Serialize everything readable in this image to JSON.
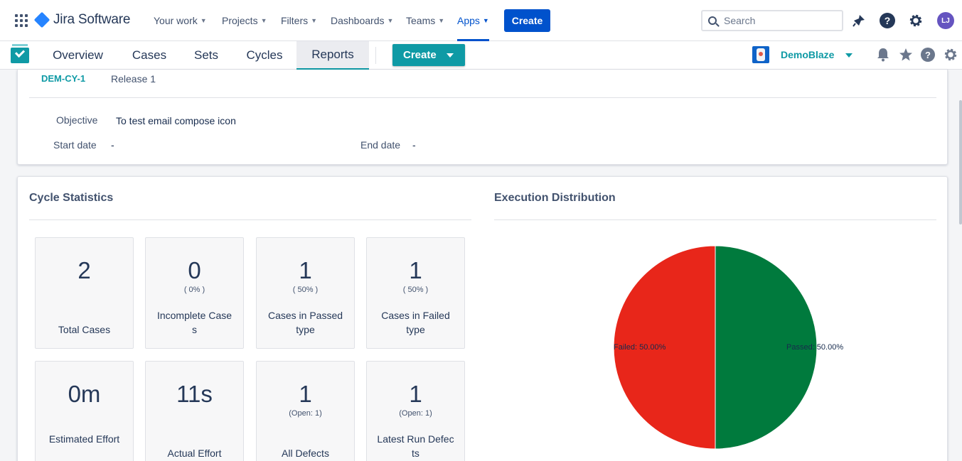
{
  "topnav": {
    "product": "Jira Software",
    "items": [
      {
        "label": "Your work"
      },
      {
        "label": "Projects"
      },
      {
        "label": "Filters"
      },
      {
        "label": "Dashboards"
      },
      {
        "label": "Teams"
      },
      {
        "label": "Apps"
      }
    ],
    "active_item": "Apps",
    "create_label": "Create",
    "search_placeholder": "Search",
    "avatar_initials": "LJ",
    "help_glyph": "?",
    "icons": [
      "app-switcher-icon",
      "jira-logo-icon",
      "search-icon",
      "notifications-icon",
      "help-icon",
      "settings-icon"
    ]
  },
  "appbar": {
    "tabs": [
      {
        "label": "Overview"
      },
      {
        "label": "Cases"
      },
      {
        "label": "Sets"
      },
      {
        "label": "Cycles"
      },
      {
        "label": "Reports"
      }
    ],
    "active_tab": "Reports",
    "create_label": "Create",
    "project": "DemoBlaze",
    "help_glyph": "?",
    "icons": [
      "app-logo-icon",
      "project-icon",
      "bell-icon",
      "star-icon",
      "help-icon",
      "gear-icon"
    ]
  },
  "cycle": {
    "key": "DEM-CY-1",
    "name": "Release 1",
    "objective_label": "Objective",
    "objective": "To test email compose icon",
    "start_label": "Start date",
    "start_value": "-",
    "end_label": "End date",
    "end_value": "-"
  },
  "stats": {
    "title": "Cycle Statistics",
    "cards": [
      {
        "value": "2",
        "sub": "",
        "label": "Total Cases"
      },
      {
        "value": "0",
        "sub": "( 0% )",
        "label": "Incomplete Cases"
      },
      {
        "value": "1",
        "sub": "( 50% )",
        "label": "Cases in Passed type"
      },
      {
        "value": "1",
        "sub": "( 50% )",
        "label": "Cases in Failed type"
      },
      {
        "value": "0m",
        "sub": "",
        "label": "Estimated Effort"
      },
      {
        "value": "11s",
        "sub": "",
        "label": "Actual Effort"
      },
      {
        "value": "1",
        "sub": "(Open: 1)",
        "label": "All Defects"
      },
      {
        "value": "1",
        "sub": "(Open: 1)",
        "label": "Latest Run Defects"
      }
    ]
  },
  "distribution": {
    "title": "Execution Distribution"
  },
  "chart_data": {
    "type": "pie",
    "title": "Execution Distribution",
    "slices": [
      {
        "name": "Passed",
        "value": 50.0,
        "label": "Passed: 50.00%",
        "color": "#007a3d"
      },
      {
        "name": "Failed",
        "value": 50.0,
        "label": "Failed: 50.00%",
        "color": "#e8261a"
      }
    ]
  }
}
